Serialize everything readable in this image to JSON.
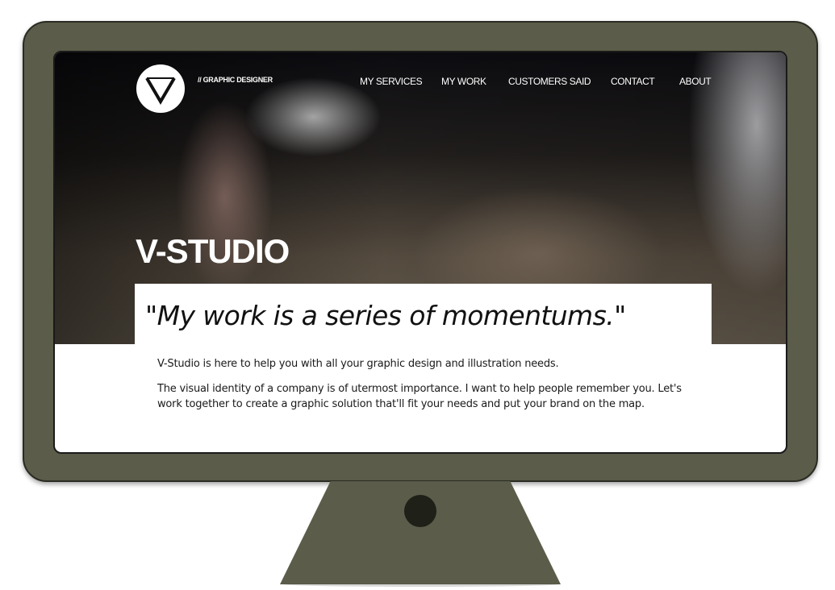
{
  "site": {
    "logo_letter": "V",
    "tagline": "// GRAPHIC DESIGNER",
    "title": "V-STUDIO",
    "quote": "\"My work is a series of momentums.\"",
    "nav": [
      {
        "label": "MY SERVICES"
      },
      {
        "label": "MY WORK"
      },
      {
        "label": "CUSTOMERS SAID"
      },
      {
        "label": "CONTACT"
      },
      {
        "label": "ABOUT"
      }
    ],
    "paragraphs": [
      "V-Studio is here to help you with all your graphic design and illustration needs.",
      "The visual identity of a company is of utermost importance. I want to help people remember you. Let's work together to create a graphic solution that'll fit your needs and put your brand on the map."
    ]
  },
  "colors": {
    "monitor_frame": "#5b5c49",
    "stand_dot": "#1f2018",
    "text_dark": "#111111",
    "nav_text": "#ffffff"
  }
}
